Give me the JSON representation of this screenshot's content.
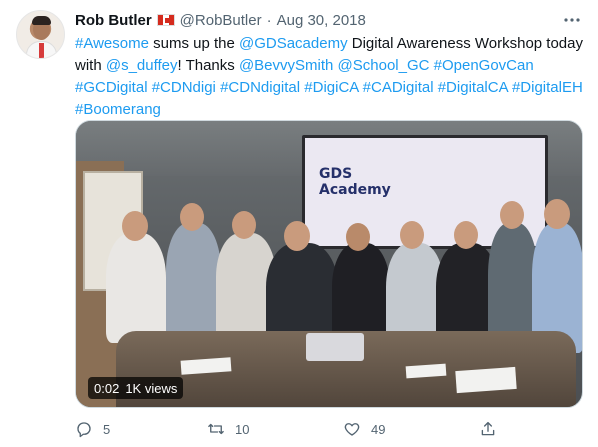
{
  "tweet": {
    "author": {
      "name": "Rob Butler",
      "flag_icon": "canada-flag-icon",
      "handle": "@RobButler",
      "separator": "·",
      "date": "Aug 30, 2018"
    },
    "more_icon": "more-horizontal-icon",
    "text_segments": [
      {
        "text": "#Awesome",
        "type": "link"
      },
      {
        "text": " sums up the ",
        "type": "plain"
      },
      {
        "text": "@GDSacademy",
        "type": "link"
      },
      {
        "text": " Digital Awareness Workshop today with ",
        "type": "plain"
      },
      {
        "text": "@s_duffey",
        "type": "link"
      },
      {
        "text": "!  Thanks ",
        "type": "plain"
      },
      {
        "text": "@BevvySmith",
        "type": "link"
      },
      {
        "text": " ",
        "type": "plain"
      },
      {
        "text": "@School_GC",
        "type": "link"
      },
      {
        "text": " ",
        "type": "plain"
      },
      {
        "text": "#OpenGovCan",
        "type": "link"
      },
      {
        "text": " ",
        "type": "plain"
      },
      {
        "text": "#GCDigital",
        "type": "link"
      },
      {
        "text": " ",
        "type": "plain"
      },
      {
        "text": "#CDNdigi",
        "type": "link"
      },
      {
        "text": " ",
        "type": "plain"
      },
      {
        "text": "#CDNdigital",
        "type": "link"
      },
      {
        "text": " ",
        "type": "plain"
      },
      {
        "text": "#DigiCA",
        "type": "link"
      },
      {
        "text": " ",
        "type": "plain"
      },
      {
        "text": "#CADigital",
        "type": "link"
      },
      {
        "text": " ",
        "type": "plain"
      },
      {
        "text": "#DigitalCA",
        "type": "link"
      },
      {
        "text": " ",
        "type": "plain"
      },
      {
        "text": "#DigitalEH",
        "type": "link"
      },
      {
        "text": " ",
        "type": "plain"
      },
      {
        "text": "#Boomerang",
        "type": "link"
      }
    ],
    "link_color": "#1d9bf0",
    "media": {
      "screen_text_line1": "GDS",
      "screen_text_line2": "Academy",
      "duration": "0:02",
      "views": "1K views"
    },
    "actions": {
      "replies": "5",
      "retweets": "10",
      "likes": "49",
      "reply_icon": "reply-icon",
      "retweet_icon": "retweet-icon",
      "like_icon": "heart-icon",
      "share_icon": "share-icon"
    }
  }
}
